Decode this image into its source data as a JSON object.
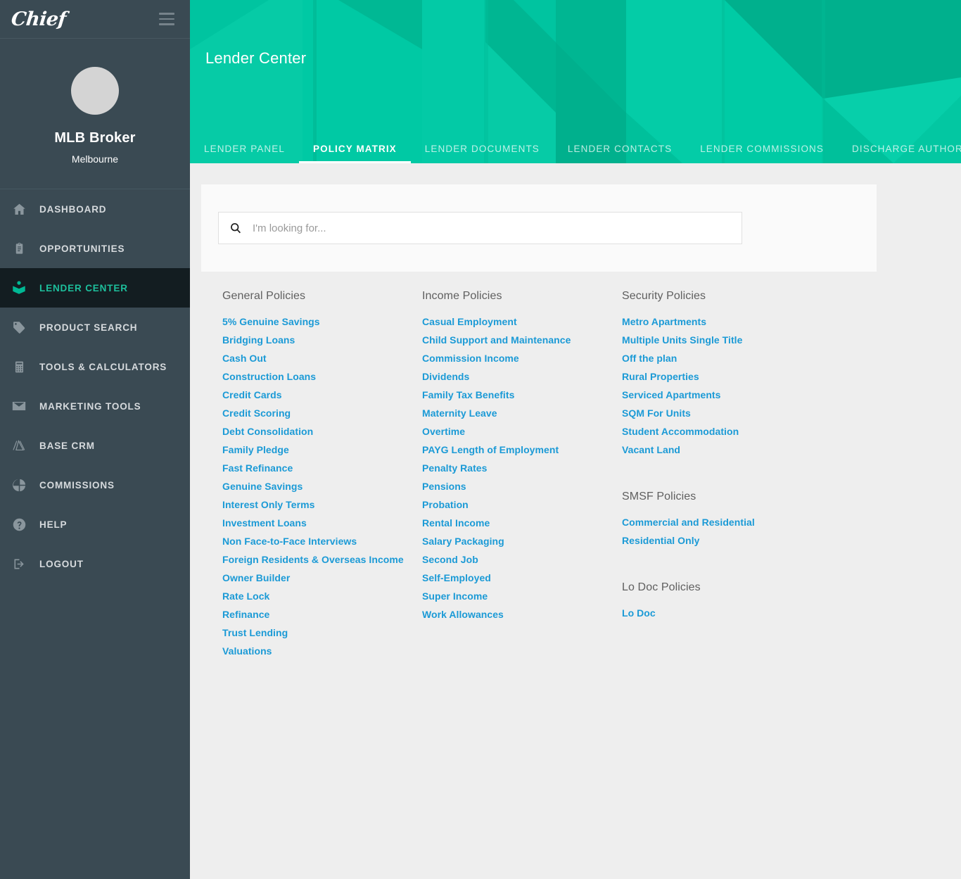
{
  "brand": {
    "logo_text": "Chief",
    "accent": "#00c4a0",
    "sidebar_bg": "#3a4a53",
    "link_color": "#1b9ad6"
  },
  "sidebar": {
    "menu_icon": "hamburger-icon",
    "profile": {
      "name": "MLB Broker",
      "location": "Melbourne",
      "avatar": "avatar-placeholder"
    },
    "items": [
      {
        "label": "DASHBOARD",
        "icon": "home-icon",
        "active": false
      },
      {
        "label": "OPPORTUNITIES",
        "icon": "clipboard-icon",
        "active": false
      },
      {
        "label": "LENDER CENTER",
        "icon": "lender-book-icon",
        "active": true
      },
      {
        "label": "PRODUCT SEARCH",
        "icon": "tag-icon",
        "active": false
      },
      {
        "label": "TOOLS & CALCULATORS",
        "icon": "calculator-icon",
        "active": false
      },
      {
        "label": "MARKETING TOOLS",
        "icon": "envelope-icon",
        "active": false
      },
      {
        "label": "BASE CRM",
        "icon": "base-crm-icon",
        "active": false
      },
      {
        "label": "COMMISSIONS",
        "icon": "pie-chart-icon",
        "active": false
      },
      {
        "label": "HELP",
        "icon": "question-circle-icon",
        "active": false
      },
      {
        "label": "LOGOUT",
        "icon": "logout-icon",
        "active": false
      }
    ]
  },
  "hero": {
    "title": "Lender Center"
  },
  "tabs": [
    {
      "label": "LENDER PANEL",
      "active": false
    },
    {
      "label": "POLICY MATRIX",
      "active": true
    },
    {
      "label": "LENDER DOCUMENTS",
      "active": false
    },
    {
      "label": "LENDER CONTACTS",
      "active": false
    },
    {
      "label": "LENDER COMMISSIONS",
      "active": false
    },
    {
      "label": "DISCHARGE AUTHORITIES",
      "active": false
    }
  ],
  "search": {
    "placeholder": "I'm looking for...",
    "value": "",
    "icon": "search-icon"
  },
  "policy_columns": [
    {
      "groups": [
        {
          "title": "General Policies",
          "links": [
            "5% Genuine Savings",
            "Bridging Loans",
            "Cash Out",
            "Construction Loans",
            "Credit Cards",
            "Credit Scoring",
            "Debt Consolidation",
            "Family Pledge",
            "Fast Refinance",
            "Genuine Savings",
            "Interest Only Terms",
            "Investment Loans",
            "Non Face-to-Face Interviews",
            "Foreign Residents & Overseas Income",
            "Owner Builder",
            "Rate Lock",
            "Refinance",
            "Trust Lending",
            "Valuations"
          ]
        }
      ]
    },
    {
      "groups": [
        {
          "title": "Income Policies",
          "links": [
            "Casual Employment",
            "Child Support and Maintenance",
            "Commission Income",
            "Dividends",
            "Family Tax Benefits",
            "Maternity Leave",
            "Overtime",
            "PAYG Length of Employment",
            "Penalty Rates",
            "Pensions",
            "Probation",
            "Rental Income",
            "Salary Packaging",
            "Second Job",
            "Self-Employed",
            "Super Income",
            "Work Allowances"
          ]
        }
      ]
    },
    {
      "groups": [
        {
          "title": "Security Policies",
          "links": [
            "Metro Apartments",
            "Multiple Units Single Title",
            "Off the plan",
            "Rural Properties",
            "Serviced Apartments",
            "SQM For Units",
            "Student Accommodation",
            "Vacant Land"
          ]
        },
        {
          "title": "SMSF Policies",
          "links": [
            "Commercial and Residential",
            "Residential Only"
          ]
        },
        {
          "title": "Lo Doc Policies",
          "links": [
            "Lo Doc"
          ]
        }
      ]
    }
  ]
}
